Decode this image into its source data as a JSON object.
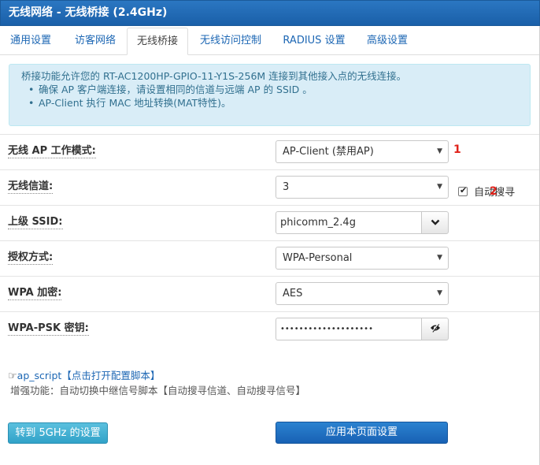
{
  "window": {
    "title": "无线网络 - 无线桥接 (2.4GHz)"
  },
  "tabs": [
    {
      "label": "通用设置",
      "active": false
    },
    {
      "label": "访客网络",
      "active": false
    },
    {
      "label": "无线桥接",
      "active": true
    },
    {
      "label": "无线访问控制",
      "active": false
    },
    {
      "label": "RADIUS 设置",
      "active": false
    },
    {
      "label": "高级设置",
      "active": false
    }
  ],
  "info": {
    "intro": "桥接功能允许您的 RT-AC1200HP-GPIO-11-Y1S-256M 连接到其他接入点的无线连接。",
    "bullets": [
      "确保 AP 客户端连接，请设置相同的信道与远端 AP 的 SSID 。",
      "AP-Client 执行 MAC 地址转换(MAT特性)。"
    ]
  },
  "form": {
    "ap_mode": {
      "label": "无线 AP 工作模式:",
      "value": "AP-Client (禁用AP)",
      "marker": "1"
    },
    "channel": {
      "label": "无线信道:",
      "value": "3",
      "auto_scan_label": "自动搜寻",
      "auto_scan_checked": true,
      "marker": "2"
    },
    "ssid": {
      "label": "上级 SSID:",
      "value": "phicomm_2.4g"
    },
    "auth": {
      "label": "授权方式:",
      "value": "WPA-Personal"
    },
    "wpa_encrypt": {
      "label": "WPA 加密:",
      "value": "AES"
    },
    "psk": {
      "label": "WPA-PSK 密钥:",
      "value": "••••••••••••••••••••"
    }
  },
  "script": {
    "link_text": "ap_script【点击打开配置脚本】",
    "description": "增强功能：自动切换中继信号脚本【自动搜寻信道、自动搜寻信号】"
  },
  "buttons": {
    "switch_5g": "转到 5GHz 的设置",
    "apply": "应用本页面设置"
  },
  "icons": {
    "hand": "pointing-hand-icon",
    "caret": "caret-down-icon",
    "chevron": "chevron-down-icon",
    "eye": "eye-slash-icon"
  }
}
